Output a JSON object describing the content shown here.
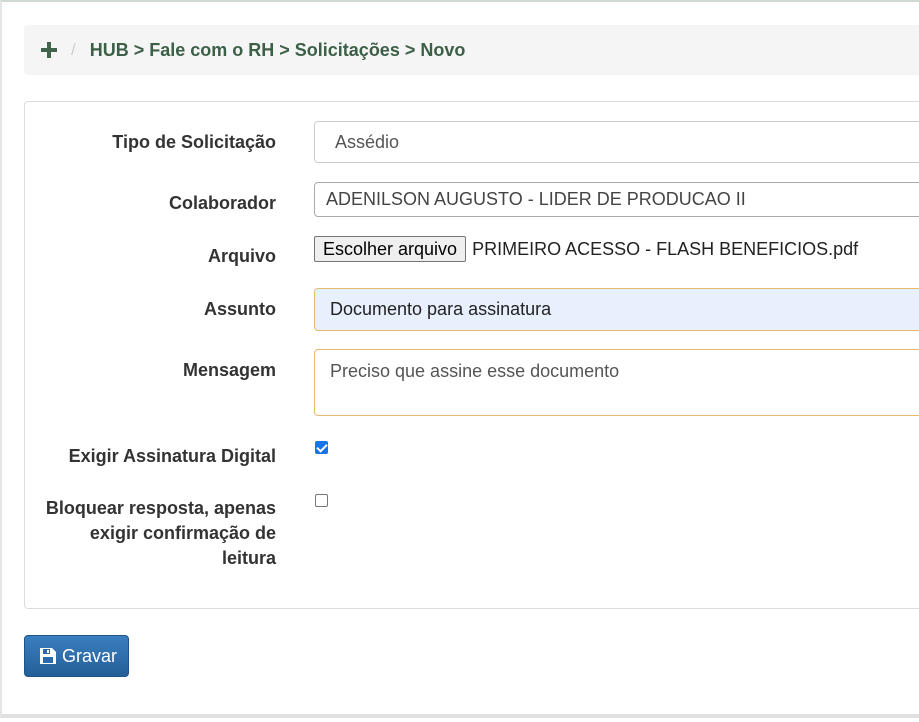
{
  "breadcrumb": {
    "separator": "/",
    "path": "HUB > Fale com o RH > Solicitações > Novo"
  },
  "form": {
    "tipo": {
      "label": "Tipo de Solicitação",
      "value": "Assédio"
    },
    "colaborador": {
      "label": "Colaborador",
      "value": "ADENILSON AUGUSTO - LIDER DE PRODUCAO II"
    },
    "arquivo": {
      "label": "Arquivo",
      "button": "Escolher arquivo",
      "file_name": "PRIMEIRO ACESSO - FLASH BENEFICIOS.pdf"
    },
    "assunto": {
      "label": "Assunto",
      "value": "Documento para assinatura"
    },
    "mensagem": {
      "label": "Mensagem",
      "value": "Preciso que assine esse documento"
    },
    "assinatura": {
      "label": "Exigir Assinatura Digital",
      "checked": true
    },
    "bloquear": {
      "label_line1": "Bloquear resposta, apenas",
      "label_line2": "exigir confirmação de",
      "label_line3": "leitura",
      "checked": false
    }
  },
  "actions": {
    "save_label": "Gravar"
  },
  "icons": {
    "add": "plus-icon",
    "save": "save-icon"
  },
  "colors": {
    "breadcrumb_text": "#3c5f47",
    "primary_button": "#2d6aa6",
    "focus_border": "#e7b96b"
  }
}
